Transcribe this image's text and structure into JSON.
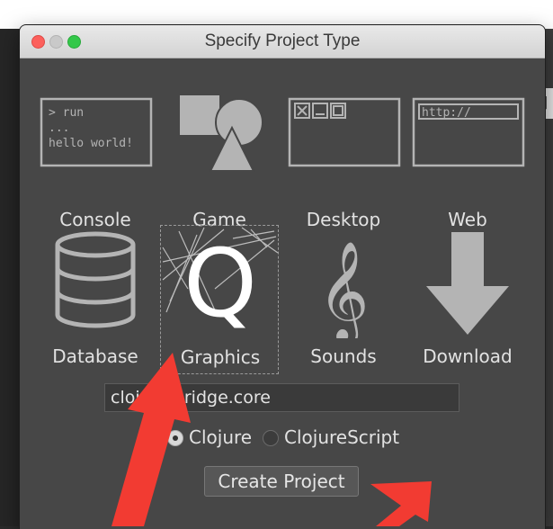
{
  "window": {
    "title": "Specify Project Type"
  },
  "project_types": [
    {
      "id": "console",
      "label": "Console",
      "icon": "terminal-icon",
      "selected": false,
      "console_lines": [
        "> run",
        "...",
        "hello world!"
      ]
    },
    {
      "id": "game",
      "label": "Game",
      "icon": "shapes-icon",
      "selected": false
    },
    {
      "id": "desktop",
      "label": "Desktop",
      "icon": "window-controls-icon",
      "selected": false
    },
    {
      "id": "web",
      "label": "Web",
      "icon": "browser-icon",
      "selected": false,
      "url_text": "http://"
    },
    {
      "id": "database",
      "label": "Database",
      "icon": "database-icon",
      "selected": false
    },
    {
      "id": "graphics",
      "label": "Graphics",
      "icon": "graphics-q-icon",
      "selected": true,
      "glyph": "Q"
    },
    {
      "id": "sounds",
      "label": "Sounds",
      "icon": "treble-clef-icon",
      "selected": false,
      "glyph": "𝄞"
    },
    {
      "id": "download",
      "label": "Download",
      "icon": "download-arrow-icon",
      "selected": false
    }
  ],
  "namespace_input": {
    "value": "clojure.bridge.core"
  },
  "language": {
    "options": [
      {
        "label": "Clojure",
        "selected": true
      },
      {
        "label": "ClojureScript",
        "selected": false
      }
    ]
  },
  "create_button": {
    "label": "Create Project"
  },
  "colors": {
    "annotation_arrow": "#f23b32",
    "window_bg": "#474747",
    "icon_gray": "#b4b4b4"
  }
}
